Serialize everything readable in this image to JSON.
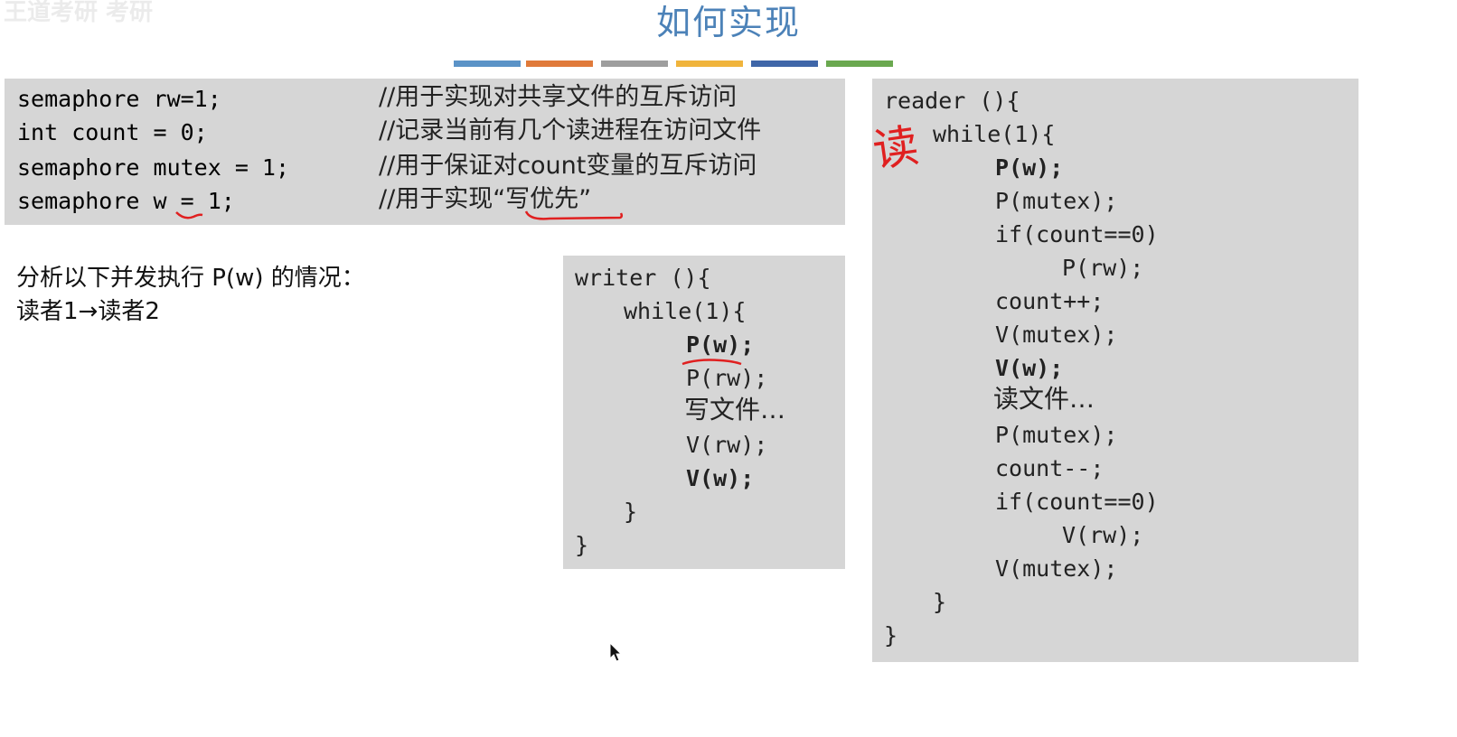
{
  "watermark": "王道考研 考研",
  "slide_title": "如何实现",
  "colors": {
    "bar1": "#5b93c7",
    "bar2": "#e07a3a",
    "bar3": "#9e9e9e",
    "bar4": "#f0b43c",
    "bar5": "#3f66a8",
    "bar6": "#6aa84f",
    "title": "#4c82b8",
    "box_bg": "#d6d6d6",
    "annotation": "#e02020"
  },
  "declarations": [
    {
      "code": "semaphore rw=1;",
      "comment": "//用于实现对共享文件的互斥访问"
    },
    {
      "code": "int count = 0;",
      "comment": "//记录当前有几个读进程在访问文件"
    },
    {
      "code": "semaphore mutex = 1;",
      "comment": "//用于保证对count变量的互斥访问"
    },
    {
      "code": "semaphore w = 1;",
      "comment": "//用于实现“写优先”"
    }
  ],
  "analysis": {
    "line1": "分析以下并发执行 P(w) 的情况：",
    "line2": "读者1→读者2"
  },
  "writer": {
    "lines": [
      "writer (){",
      "while(1){",
      "P(w);",
      "P(rw);",
      "写文件…",
      "V(rw);",
      "V(w);",
      "}",
      "}"
    ]
  },
  "reader": {
    "lines": [
      "reader (){",
      "while(1){",
      "P(w);",
      "P(mutex);",
      "if(count==0)",
      "P(rw);",
      "count++;",
      "V(mutex);",
      "V(w);",
      "读文件…",
      "P(mutex);",
      "count--;",
      "if(count==0)",
      "V(rw);",
      "V(mutex);",
      "}",
      "}"
    ]
  },
  "handwriting": {
    "reader_mark": "读"
  }
}
